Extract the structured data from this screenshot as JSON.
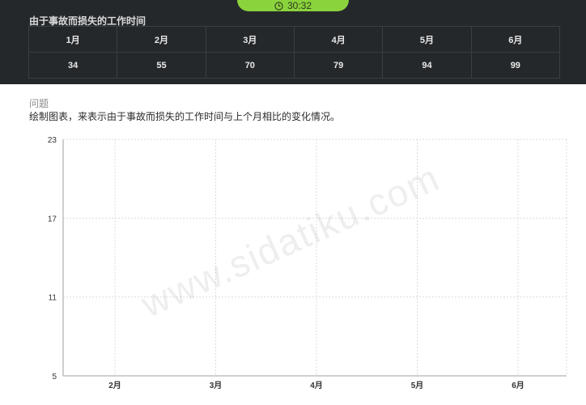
{
  "timer": {
    "time": "30:32",
    "icon": "clock-icon"
  },
  "section_title": "由于事故而损失的工作时间",
  "table": {
    "headers": [
      "1月",
      "2月",
      "3月",
      "4月",
      "5月",
      "6月"
    ],
    "values": [
      "34",
      "55",
      "70",
      "79",
      "94",
      "99"
    ]
  },
  "question": {
    "label": "问题",
    "text": "绘制图表，来表示由于事故而损失的工作时间与上个月相比的变化情况。"
  },
  "chart_data": {
    "type": "line",
    "categories": [
      "2月",
      "3月",
      "4月",
      "5月",
      "6月"
    ],
    "series": [],
    "ylim": [
      5,
      23
    ],
    "yticks": [
      5,
      11,
      17,
      23
    ],
    "grid": true
  },
  "watermark": "www.sidatiku.com"
}
